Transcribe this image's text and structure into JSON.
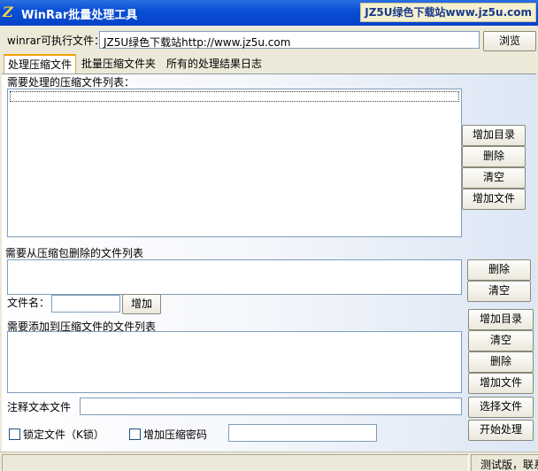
{
  "window": {
    "title": "WinRar批量处理工具",
    "app_icon_glyph": "Z",
    "site_badge": "JZ5U绿色下载站www.jz5u.com"
  },
  "exe": {
    "label": "winrar可执行文件：",
    "value": "JZ5U绿色下载站http://www.jz5u.com",
    "browse_label": "浏览"
  },
  "tabs": [
    {
      "label": "处理压缩文件",
      "active": true
    },
    {
      "label": "批量压缩文件夹",
      "active": false
    },
    {
      "label": "所有的处理结果日志",
      "active": false
    }
  ],
  "section1": {
    "title": "需要处理的压缩文件列表：",
    "buttons": [
      "增加目录",
      "删除",
      "清空",
      "增加文件"
    ]
  },
  "section2": {
    "title": "需要从压缩包删除的文件列表",
    "buttons": [
      "删除",
      "清空"
    ],
    "filename_label": "文件名：",
    "filename_value": "",
    "add_label": "增加"
  },
  "section3": {
    "title": "需要添加到压缩文件的文件列表",
    "buttons": [
      "增加目录",
      "清空",
      "删除",
      "增加文件"
    ]
  },
  "comment": {
    "label": "注释文本文件",
    "value": "",
    "select_label": "选择文件"
  },
  "options": {
    "lock_label": "锁定文件（K锁）",
    "lock_checked": false,
    "password_label": "增加压缩密码",
    "password_checked": false,
    "password_value": "",
    "start_label": "开始处理"
  },
  "status": {
    "text": "测试版，联系"
  },
  "colors": {
    "title_bar": "#0a4fd6",
    "tab_highlight": "#f0a000",
    "window_bg": "#ECE9D8"
  }
}
